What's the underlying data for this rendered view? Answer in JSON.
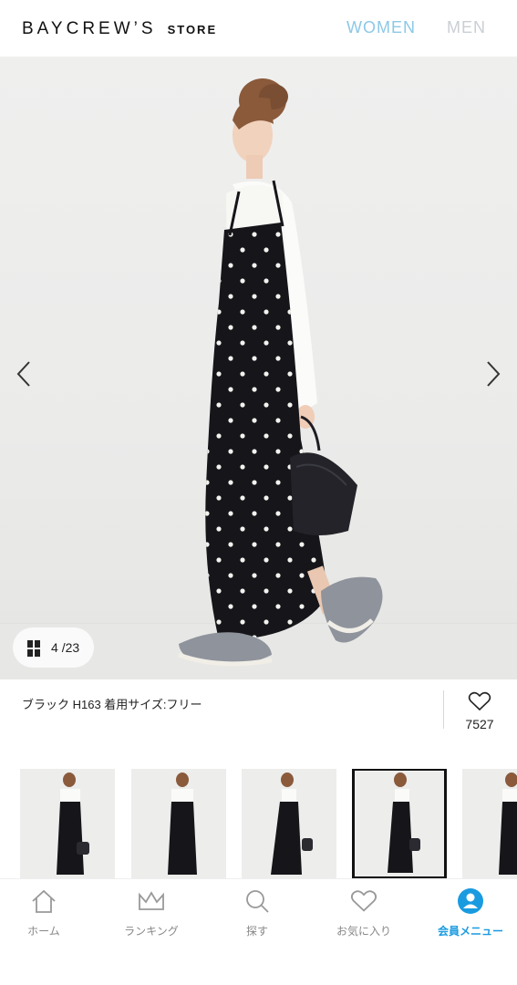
{
  "header": {
    "logo_main": "BAYCREW’S",
    "logo_sub": "STORE",
    "nav_women": "WOMEN",
    "nav_men": "MEN"
  },
  "gallery": {
    "current": "4",
    "total": "/23",
    "prev_icon": "chevron-left-icon",
    "next_icon": "chevron-right-icon"
  },
  "product": {
    "caption": "ブラック H163 着用サイズ:フリー",
    "favorite_count": "7527"
  },
  "bottom_nav": {
    "items": [
      {
        "label": "ホーム",
        "icon": "home-icon"
      },
      {
        "label": "ランキング",
        "icon": "crown-icon"
      },
      {
        "label": "探す",
        "icon": "search-icon"
      },
      {
        "label": "お気に入り",
        "icon": "heart-icon"
      },
      {
        "label": "会員メニュー",
        "icon": "user-icon"
      }
    ]
  },
  "colors": {
    "accent": "#1a9be0",
    "women_nav": "#8cc8e6",
    "men_nav": "#c9cfd4"
  }
}
